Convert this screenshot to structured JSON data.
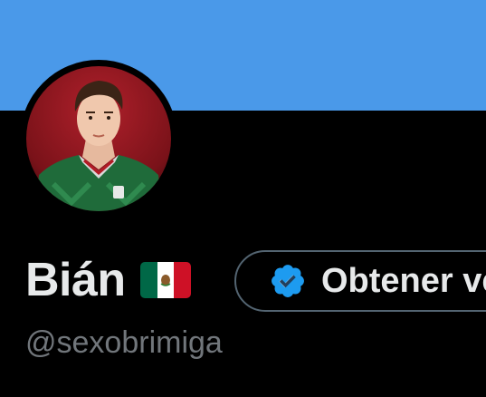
{
  "colors": {
    "banner": "#4a99e9",
    "background": "#000000",
    "name_text": "#e7e9ea",
    "handle_text": "#71767b",
    "button_border": "#536471",
    "verified_badge": "#1d9bf0"
  },
  "header": {
    "banner_icon": "profile-banner"
  },
  "profile": {
    "avatar_icon": "profile-photo",
    "display_name": "Bián",
    "flag_icon": "mexico-flag",
    "handle": "@sexobrimiga"
  },
  "actions": {
    "get_verified_label": "Obtener verificación",
    "badge_icon": "verified-badge-icon"
  }
}
